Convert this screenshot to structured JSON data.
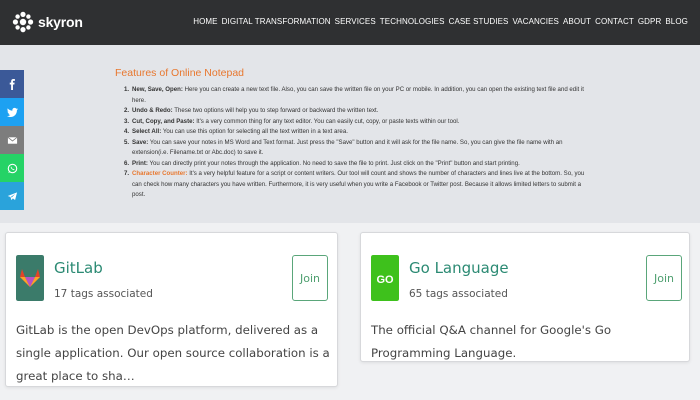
{
  "brand": {
    "name": "skyron"
  },
  "nav": {
    "items": [
      "HOME",
      "DIGITAL TRANSFORMATION",
      "SERVICES",
      "TECHNOLOGIES",
      "CASE STUDIES",
      "VACANCIES",
      "ABOUT",
      "CONTACT",
      "GDPR",
      "BLOG"
    ]
  },
  "social": {
    "items": [
      "facebook-icon",
      "twitter-icon",
      "email-icon",
      "whatsapp-icon",
      "telegram-icon"
    ],
    "colors": {
      "facebook": "#3b5998",
      "twitter": "#1da1f2",
      "email": "#7d7d7d",
      "whatsapp": "#25d366",
      "telegram": "#2aa3db"
    }
  },
  "article": {
    "title": "Features of Online Notepad",
    "items": [
      {
        "num": "1.",
        "label": "New, Save, Open:",
        "text": " Here you can create a new text file. Also, you can save the written file on your PC or mobile. In addition, you can open the existing text file and edit it here."
      },
      {
        "num": "2.",
        "label": "Undo & Redo:",
        "text": " These two options will help you to step forward or backward the written text."
      },
      {
        "num": "3.",
        "label": "Cut, Copy, and Paste:",
        "text": " It's a very common thing for any text editor. You can easily cut, copy, or paste texts within our tool."
      },
      {
        "num": "4.",
        "label": "Select All:",
        "text": " You can use this option for selecting all the text written in a text area."
      },
      {
        "num": "5.",
        "label": "Save:",
        "text": " You can save your notes in MS Word and Text format. Just press the \"Save\" button and it will ask for the file name. So, you can give the file name with an extension(i.e. Filename.txt or Abc.doc) to save it."
      },
      {
        "num": "6.",
        "label": "Print:",
        "text": " You can directly print your notes through the application. No need to save the file to print. Just click on the \"Print\" button and start printing."
      },
      {
        "num": "7.",
        "label": "Character Counter:",
        "text": " It's a very helpful feature for a script or content writers. Our tool will count and shows the number of characters and lines live at the bottom. So, you can check how many characters you have written. Furthermore, it is very useful when you write a Facebook or Twitter post. Because it allows limited letters to submit a post."
      }
    ]
  },
  "cards": [
    {
      "name": "GitLab",
      "tags": "17 tags associated",
      "join_label": "Join",
      "description": "GitLab is the open DevOps platform, delivered as a single application. Our open source collaboration is a great place to sha…",
      "icon": "gitlab-icon",
      "icon_color": "#3b7b6a"
    },
    {
      "name": "Go Language",
      "tags": "65 tags associated",
      "join_label": "Join",
      "description": "The official Q&A channel for Google's Go Programming Language.",
      "icon": "go-language-icon",
      "icon_color": "#3ec11c",
      "icon_text": "GO"
    }
  ]
}
